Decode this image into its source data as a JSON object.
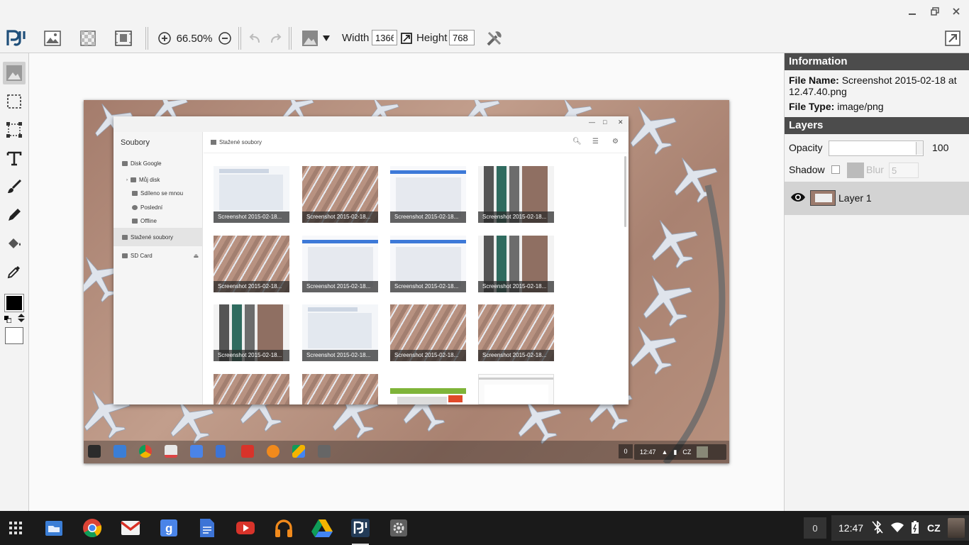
{
  "toolbar": {
    "zoom": "66.50%",
    "width_label": "Width",
    "width_value": "1366",
    "height_label": "Height",
    "height_value": "768"
  },
  "image": {
    "files_app": {
      "sidebar_title": "Soubory",
      "sidebar_items": [
        "Disk Google",
        "Můj disk",
        "Sdíleno se mnou",
        "Poslední",
        "Offline",
        "Stažené soubory",
        "SD Card"
      ],
      "header_title": "Stažené soubory",
      "thumb_caption": "Screenshot 2015-02-18..."
    },
    "shelf": {
      "notif_count": "0",
      "time": "12:47",
      "locale": "CZ"
    }
  },
  "panel": {
    "info_title": "Information",
    "file_name_label": "File Name:",
    "file_name": "Screenshot 2015-02-18 at 12.47.40.png",
    "file_type_label": "File Type:",
    "file_type": "image/png",
    "layers_title": "Layers",
    "opacity_label": "Opacity",
    "opacity_value": "100",
    "shadow_label": "Shadow",
    "blur_label": "Blur",
    "blur_value": "5",
    "layer_name": "Layer 1"
  },
  "shelf": {
    "notif_count": "0",
    "time": "12:47",
    "locale": "CZ"
  },
  "colors": {
    "panel_header": "#4c4c4c",
    "shelf": "#1a1a1a",
    "accent_blue": "#3d79d8"
  }
}
